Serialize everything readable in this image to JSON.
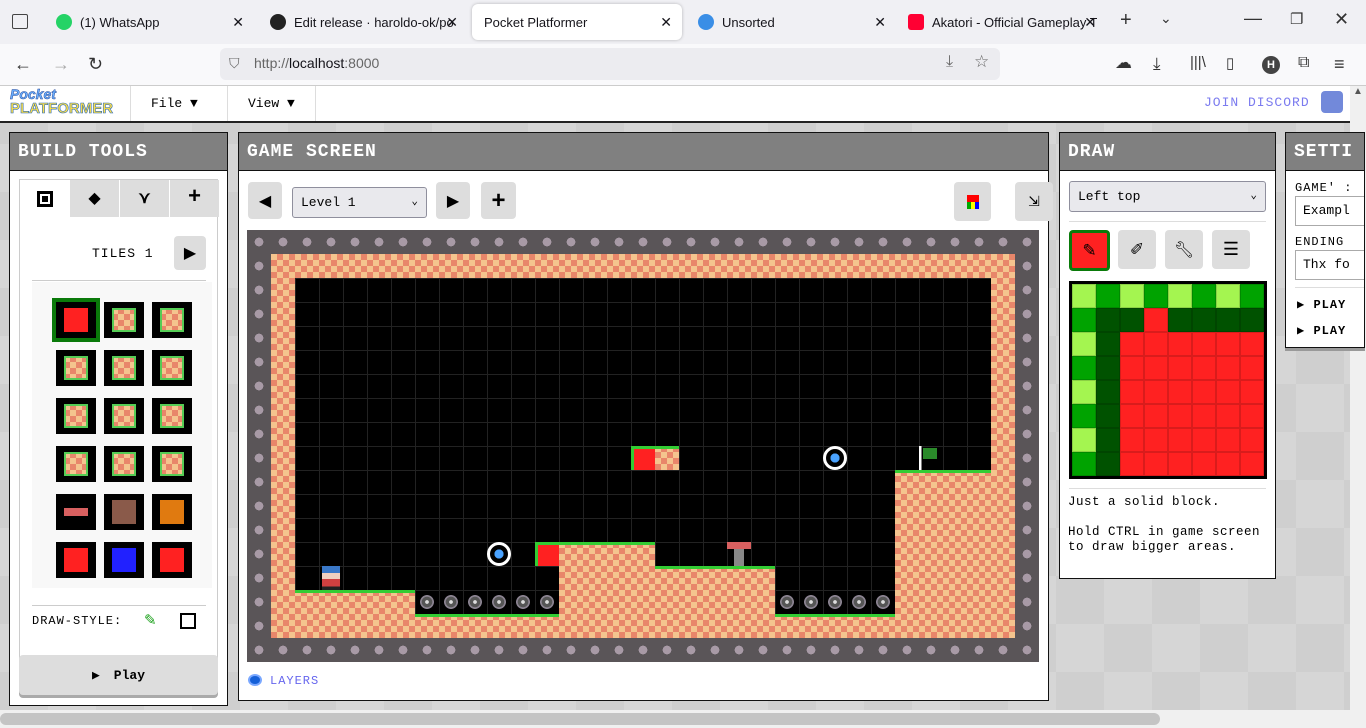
{
  "browser": {
    "tabs": [
      {
        "label": "(1) WhatsApp",
        "badge": "1",
        "icon": "whatsapp-icon",
        "color": "#25d366"
      },
      {
        "label": "Edit release · haroldo-ok/pock",
        "icon": "github-icon",
        "color": "#222222"
      },
      {
        "label": "Pocket Platformer",
        "active": true
      },
      {
        "label": "Unsorted",
        "icon": "raindrop-icon",
        "color": "#3a8ee6"
      },
      {
        "label": "Akatori - Official Gameplay Tr",
        "icon": "youtube-icon",
        "color": "#ff0033"
      }
    ],
    "url_prefix": "http://",
    "url_host": "localhost",
    "url_port": ":8000",
    "profile_initial": "H"
  },
  "app": {
    "logo_top": "Pocket",
    "logo_bottom": "PLATFORMER",
    "menus": [
      "File ▼",
      "View ▼"
    ],
    "join_discord": "JOIN DISCORD"
  },
  "build_tools": {
    "title": "BUILD TOOLS",
    "tabs": [
      "tiles-icon",
      "objects-icon",
      "sprite-icon",
      "add-icon"
    ],
    "page_label": "TILES 1",
    "draw_style_label": "DRAW-STYLE:",
    "play_label": "Play"
  },
  "game_screen": {
    "title": "GAME SCREEN",
    "level": "Level 1",
    "layers_label": "LAYERS"
  },
  "draw": {
    "title": "DRAW",
    "position": "Left top",
    "tools": [
      "pen-icon",
      "eyedropper-icon",
      "wrench-icon",
      "list-icon"
    ],
    "colors": {
      "light": "#a4f550",
      "green": "#00a300",
      "dark": "#005200",
      "red": "#ff2121"
    },
    "description": "Just a solid block.",
    "hint": "Hold CTRL in game screen to draw bigger areas."
  },
  "settings": {
    "title": "SETTI",
    "game_label": "GAME' :",
    "game_value": "Exampl",
    "ending_label": "ENDING",
    "ending_value": "Thx fo",
    "sections": [
      "PLAY",
      "PLAY"
    ]
  }
}
